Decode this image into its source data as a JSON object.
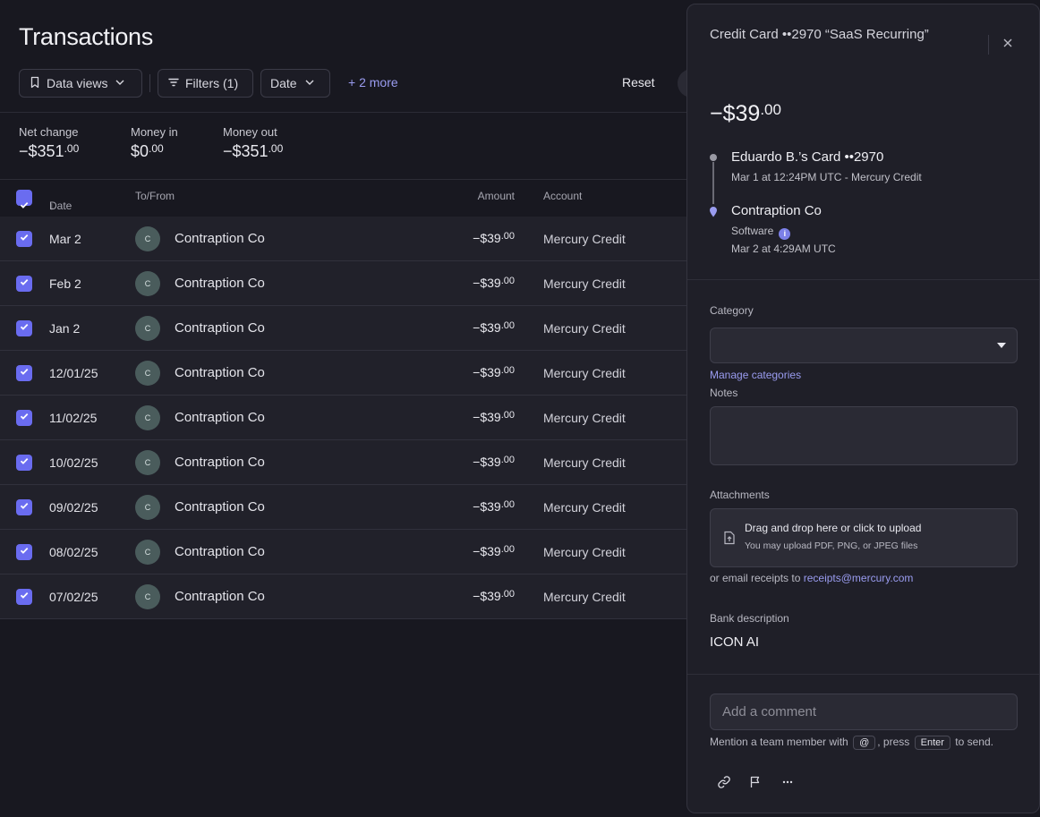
{
  "page": {
    "title": "Transactions"
  },
  "toolbar": {
    "data_views": "Data views",
    "filters": "Filters (1)",
    "date": "Date",
    "more": "+ 2 more",
    "reset": "Reset"
  },
  "stats": [
    {
      "label": "Net change",
      "value": "−$351",
      "cents": ".00"
    },
    {
      "label": "Money in",
      "value": "$0",
      "cents": ".00"
    },
    {
      "label": "Money out",
      "value": "−$351",
      "cents": ".00"
    }
  ],
  "table": {
    "headers": {
      "date": "Date",
      "to_from": "To/From",
      "amount": "Amount",
      "account": "Account"
    },
    "rows": [
      {
        "date": "Mar 2",
        "initial": "C",
        "name": "Contraption Co",
        "amount": "−$39",
        "cents": ".00",
        "account": "Mercury Credit"
      },
      {
        "date": "Feb 2",
        "initial": "C",
        "name": "Contraption Co",
        "amount": "−$39",
        "cents": ".00",
        "account": "Mercury Credit"
      },
      {
        "date": "Jan 2",
        "initial": "C",
        "name": "Contraption Co",
        "amount": "−$39",
        "cents": ".00",
        "account": "Mercury Credit"
      },
      {
        "date": "12/01/25",
        "initial": "C",
        "name": "Contraption Co",
        "amount": "−$39",
        "cents": ".00",
        "account": "Mercury Credit"
      },
      {
        "date": "11/02/25",
        "initial": "C",
        "name": "Contraption Co",
        "amount": "−$39",
        "cents": ".00",
        "account": "Mercury Credit"
      },
      {
        "date": "10/02/25",
        "initial": "C",
        "name": "Contraption Co",
        "amount": "−$39",
        "cents": ".00",
        "account": "Mercury Credit"
      },
      {
        "date": "09/02/25",
        "initial": "C",
        "name": "Contraption Co",
        "amount": "−$39",
        "cents": ".00",
        "account": "Mercury Credit"
      },
      {
        "date": "08/02/25",
        "initial": "C",
        "name": "Contraption Co",
        "amount": "−$39",
        "cents": ".00",
        "account": "Mercury Credit"
      },
      {
        "date": "07/02/25",
        "initial": "C",
        "name": "Contraption Co",
        "amount": "−$39",
        "cents": ".00",
        "account": "Mercury Credit"
      }
    ]
  },
  "panel": {
    "title": "Credit Card ••2970 “SaaS Recurring”",
    "amount": "−$39",
    "amount_cents": ".00",
    "from": {
      "title": "Eduardo B.’s Card ••2970",
      "subtitle": "Mar 1 at 12:24PM UTC - Mercury Credit"
    },
    "to": {
      "title": "Contraption Co",
      "category": "Software",
      "subtitle": "Mar 2 at 4:29AM UTC"
    },
    "category_label": "Category",
    "manage_categories": "Manage categories",
    "notes_label": "Notes",
    "attachments_label": "Attachments",
    "upload_title": "Drag and drop here or click to upload",
    "upload_sub": "You may upload PDF, PNG, or JPEG files",
    "email_prefix": "or email receipts to",
    "email": "receipts@mercury.com",
    "bank_description_label": "Bank description",
    "bank_description": "ICON AI",
    "comment_placeholder": "Add a comment",
    "hint": {
      "part1": "Mention a team member with",
      "key1": "@",
      "part2": ", press",
      "key2": "Enter",
      "part3": "to send."
    }
  },
  "colors": {
    "accent": "#6a6cf0",
    "link": "#9a9cf0",
    "background": "#181820",
    "panel": "#1f1f28"
  },
  "icons": [
    "bookmark-icon",
    "filter-icon",
    "chevron-down-icon",
    "sort-arrow-icon",
    "check-icon",
    "close-icon",
    "info-icon",
    "upload-file-icon",
    "link-icon",
    "flag-icon",
    "more-icon"
  ]
}
